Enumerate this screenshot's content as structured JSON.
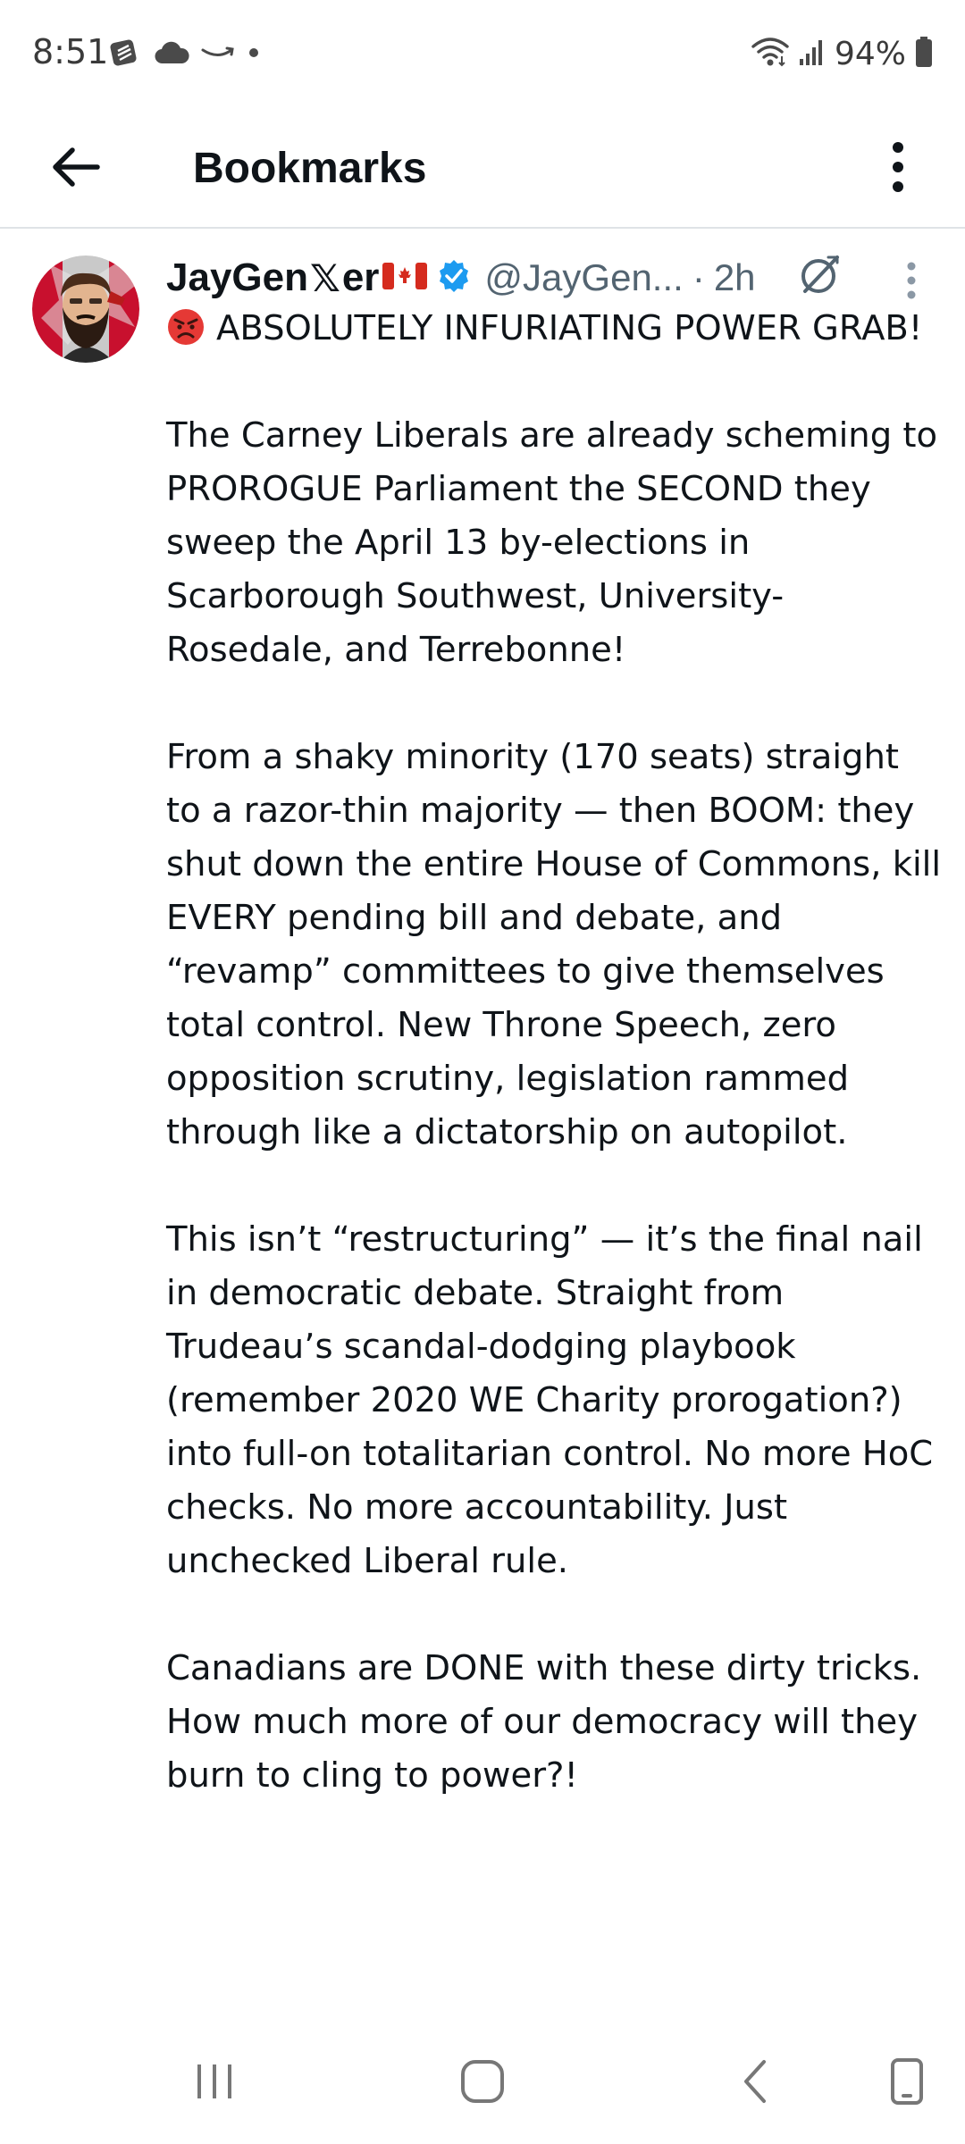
{
  "status_bar": {
    "time": "8:51",
    "battery": "94%",
    "left_icons": [
      "notification-app-icon",
      "cloud-icon",
      "amazon-icon",
      "dot-icon"
    ],
    "right_icons": [
      "wifi-icon",
      "signal-icon",
      "battery-icon"
    ]
  },
  "header": {
    "title": "Bookmarks",
    "back_icon": "arrow-left-icon",
    "menu_icon": "more-vertical-icon"
  },
  "tweet": {
    "author_name_part1": "JayGen",
    "author_name_x": "𝕏",
    "author_name_part2": "er",
    "handle": "@JayGen...",
    "separator": "·",
    "time": "2h",
    "verified": true,
    "paragraphs": [
      "ABSOLUTELY INFURIATING POWER GRAB!",
      "The Carney Liberals are already scheming to PROROGUE Parliament the SECOND they sweep the April 13 by-elections in Scarborough Southwest, University-Rosedale, and Terrebonne!",
      "From a shaky minority (170 seats) straight to a razor-thin majority — then BOOM: they shut down the entire House of Commons, kill EVERY pending bill and debate, and “revamp” committees to give themselves total control. New Throne Speech, zero opposition scrutiny, legislation rammed through like a dictatorship on autopilot.",
      "This isn’t “restructuring” — it’s the final nail in democratic debate. Straight from Trudeau’s scandal-dodging playbook (remember 2020 WE Charity prorogation?) into full-on totalitarian control. No more HoC checks. No more accountability. Just unchecked Liberal rule.",
      "Canadians are DONE with these dirty tricks. How much more of our democracy will they burn to cling to power?!"
    ]
  },
  "colors": {
    "text_primary": "#0f1419",
    "text_secondary": "#536471",
    "verified_blue": "#1d9bf0",
    "divider": "#dfe3e6"
  }
}
